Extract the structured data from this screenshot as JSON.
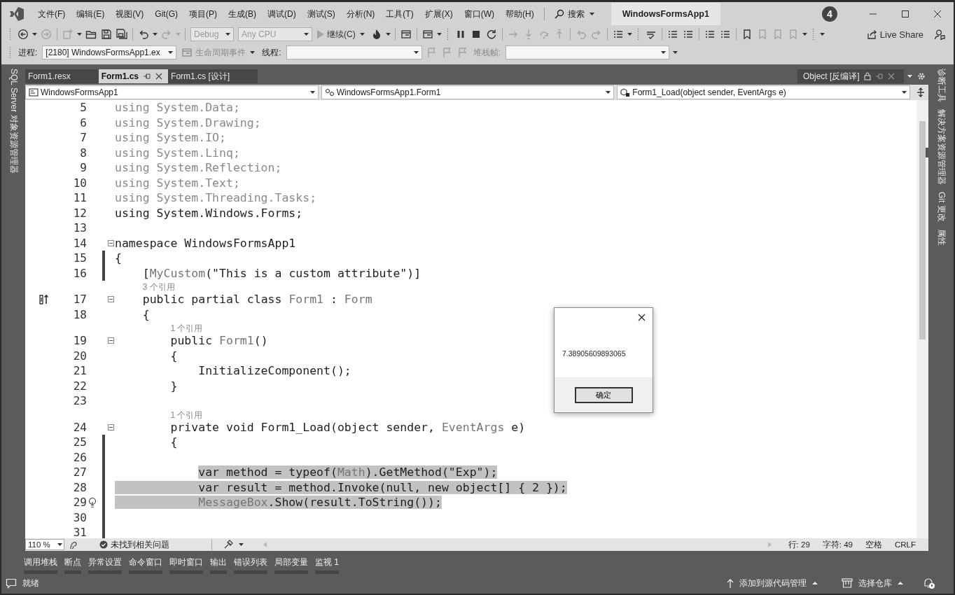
{
  "title_bar": {
    "menu": [
      "文件(F)",
      "编辑(E)",
      "视图(V)",
      "Git(G)",
      "项目(P)",
      "生成(B)",
      "调试(D)",
      "测试(S)",
      "分析(N)",
      "工具(T)",
      "扩展(X)",
      "窗口(W)",
      "帮助(H)"
    ],
    "search": "搜索",
    "solution": "WindowsFormsApp1",
    "badge": "4"
  },
  "toolbar": {
    "configuration": {
      "value": "Debug",
      "disabled": true
    },
    "platform": {
      "value": "Any CPU",
      "disabled": true
    },
    "continue": "继续(C)",
    "live_share": "Live Share"
  },
  "debug_toolbar": {
    "process_label": "进程:",
    "process": "[2180] WindowsFormsApp1.ex",
    "lifecycle": {
      "label": "生命周期事件",
      "disabled": true
    },
    "thread_label": "线程:",
    "stack_frame": {
      "label": "堆栈帧:",
      "disabled": true
    }
  },
  "left_rail": [
    "SQL Server 对象资源管理器"
  ],
  "right_rail": [
    "诊断工具",
    "解决方案资源管理器",
    "Git 更改",
    "属性"
  ],
  "document_tabs": [
    {
      "label": "Form1.resx",
      "selected": false
    },
    {
      "label": "Form1.cs",
      "selected": true
    },
    {
      "label": "Form1.cs [设计]",
      "selected": false
    }
  ],
  "side_tab": {
    "label": "Object [反编译]"
  },
  "navigation_bar": [
    "WindowsFormsApp1",
    "WindowsFormsApp1.Form1",
    "Form1_Load(object sender, EventArgs e)"
  ],
  "editor": {
    "lines": [
      {
        "number": "5",
        "tokens": [
          {
            "text": "using System.Data;",
            "kind": "faded",
            "selected": false
          }
        ]
      },
      {
        "number": "6",
        "tokens": [
          {
            "text": "using System.Drawing;",
            "kind": "faded",
            "selected": false
          }
        ]
      },
      {
        "number": "7",
        "tokens": [
          {
            "text": "using System.IO;",
            "kind": "faded",
            "selected": false
          }
        ]
      },
      {
        "number": "8",
        "tokens": [
          {
            "text": "using System.Linq;",
            "kind": "faded",
            "selected": false
          }
        ]
      },
      {
        "number": "9",
        "tokens": [
          {
            "text": "using System.Reflection;",
            "kind": "faded",
            "selected": false
          }
        ]
      },
      {
        "number": "10",
        "tokens": [
          {
            "text": "using System.Text;",
            "kind": "faded",
            "selected": false
          }
        ]
      },
      {
        "number": "11",
        "tokens": [
          {
            "text": "using System.Threading.Tasks;",
            "kind": "faded",
            "selected": false
          }
        ]
      },
      {
        "number": "12",
        "tokens": [
          {
            "text": "using System.Windows.Forms;",
            "kind": "plain",
            "selected": false
          }
        ]
      },
      {
        "number": "13"
      },
      {
        "number": "14",
        "collapsible": true,
        "tokens": [
          {
            "text": "namespace WindowsFormsApp1",
            "kind": "plain",
            "selected": false
          }
        ]
      },
      {
        "number": "15",
        "changed": true,
        "tokens": [
          {
            "text": "{",
            "kind": "plain",
            "selected": false
          }
        ]
      },
      {
        "number": "16",
        "changed": true,
        "tokens": [
          {
            "text": "    [",
            "kind": "plain",
            "selected": false
          },
          {
            "text": "MyCustom",
            "kind": "type",
            "selected": false
          },
          {
            "text": "(\"This is a custom attribute\")]",
            "kind": "plain",
            "selected": false
          }
        ]
      },
      {
        "number": "17",
        "lens": "3 个引用",
        "collapsible": true,
        "base_marker": true,
        "tokens": [
          {
            "text": "    public partial class ",
            "kind": "plain",
            "selected": false
          },
          {
            "text": "Form1",
            "kind": "type",
            "selected": false
          },
          {
            "text": " : ",
            "kind": "plain",
            "selected": false
          },
          {
            "text": "Form",
            "kind": "type",
            "selected": false
          }
        ]
      },
      {
        "number": "18",
        "tokens": [
          {
            "text": "    {",
            "kind": "plain",
            "selected": false
          }
        ]
      },
      {
        "number": "19",
        "lens": "1 个引用",
        "collapsible": true,
        "tokens": [
          {
            "text": "        public ",
            "kind": "plain",
            "selected": false
          },
          {
            "text": "Form1",
            "kind": "type",
            "selected": false
          },
          {
            "text": "()",
            "kind": "plain",
            "selected": false
          }
        ]
      },
      {
        "number": "20",
        "tokens": [
          {
            "text": "        {",
            "kind": "plain",
            "selected": false
          }
        ]
      },
      {
        "number": "21",
        "tokens": [
          {
            "text": "            InitializeComponent();",
            "kind": "plain",
            "selected": false
          }
        ]
      },
      {
        "number": "22",
        "tokens": [
          {
            "text": "        }",
            "kind": "plain",
            "selected": false
          }
        ]
      },
      {
        "number": "23"
      },
      {
        "number": "24",
        "lens": "1 个引用",
        "collapsible": true,
        "tokens": [
          {
            "text": "        private void Form1_Load(object sender, ",
            "kind": "plain",
            "selected": false
          },
          {
            "text": "EventArgs",
            "kind": "type",
            "selected": false
          },
          {
            "text": " e)",
            "kind": "plain",
            "selected": false
          }
        ]
      },
      {
        "number": "25",
        "changed": true,
        "tokens": [
          {
            "text": "        {",
            "kind": "plain",
            "selected": false
          }
        ]
      },
      {
        "number": "26",
        "changed": true
      },
      {
        "number": "27",
        "changed": true,
        "indent_selected": false,
        "tokens": [
          {
            "text": "            var method = typeof(",
            "kind": "plain",
            "selected": true
          },
          {
            "text": "Math",
            "kind": "type",
            "selected": true
          },
          {
            "text": ").GetMethod(\"Exp\");",
            "kind": "plain",
            "selected": true
          }
        ]
      },
      {
        "number": "28",
        "changed": true,
        "indent_selected": true,
        "tokens": [
          {
            "text": "            var result = method.Invoke(null, new object[] { 2 });",
            "kind": "plain",
            "selected": true
          }
        ]
      },
      {
        "number": "29",
        "changed": true,
        "lightbulb": true,
        "indent_selected": true,
        "tokens": [
          {
            "text": "            MessageBox",
            "kind": "type",
            "selected": true
          },
          {
            "text": ".Show(result.ToString());",
            "kind": "plain",
            "selected": true
          }
        ]
      },
      {
        "number": "30",
        "changed": true
      },
      {
        "number": "31",
        "changed": true
      }
    ]
  },
  "message_box": {
    "text": "7.38905609893065",
    "button": "确定"
  },
  "editor_status": {
    "zoom": "110 %",
    "issues": "未找到相关问题",
    "line": "行: 29",
    "char": "字符: 49",
    "indent": "空格",
    "eol": "CRLF"
  },
  "tool_windows": [
    "调用堆栈",
    "断点",
    "异常设置",
    "命令窗口",
    "即时窗口",
    "输出",
    "错误列表",
    "局部变量",
    "监视 1"
  ],
  "status_bar": {
    "status": "就绪",
    "source_control": "添加到源代码管理",
    "repository": "选择仓库"
  }
}
